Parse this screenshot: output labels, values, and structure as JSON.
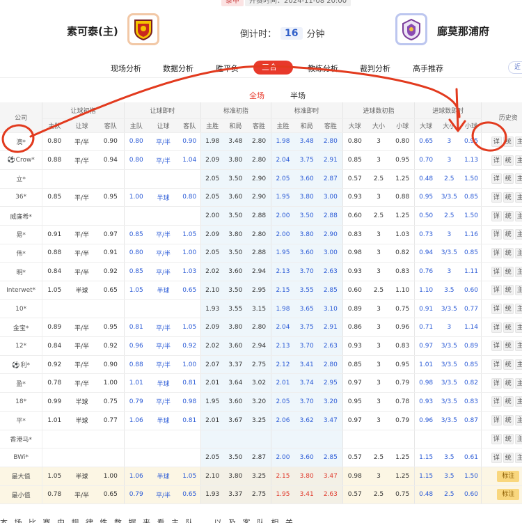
{
  "top": {
    "league": "泰甲",
    "kickoff": "开赛时间：2024-11-08 20:00"
  },
  "match": {
    "home": "素可泰(主)",
    "away": "廊莫那浦府",
    "countdown_label": "倒计时：",
    "countdown_value": "16",
    "countdown_unit": "分钟"
  },
  "nav": {
    "tabs": [
      "现场分析",
      "数据分析",
      "胜平负",
      "三合一",
      "教练分析",
      "裁判分析",
      "高手推荐"
    ],
    "active": "三合一",
    "more": "近"
  },
  "subtabs": {
    "items": [
      "全场",
      "半场"
    ],
    "active": "全场"
  },
  "table": {
    "group_headers": [
      "让球初指",
      "让球即时",
      "标准初指",
      "标准即时",
      "进球数初指",
      "进球数即时",
      "历史资"
    ],
    "company_header": "公司",
    "sub_headers": {
      "handicap": [
        "主队",
        "让球",
        "客队"
      ],
      "standard": [
        "主胜",
        "和局",
        "客胜"
      ],
      "goals": [
        "大球",
        "大小",
        "小球"
      ]
    },
    "action_labels": [
      "详",
      "统",
      "主"
    ],
    "note_label": "标注",
    "rows": [
      {
        "company": "澳*",
        "ball": false,
        "ah_init": [
          "0.80",
          "平/半",
          "0.90"
        ],
        "ah_live": [
          "0.80",
          "平/半",
          "0.90"
        ],
        "std_init": [
          "1.98",
          "3.48",
          "2.80"
        ],
        "std_live": [
          "1.98",
          "3.48",
          "2.80"
        ],
        "ou_init": [
          "0.80",
          "3",
          "0.80"
        ],
        "ou_live": [
          "0.65",
          "3",
          "0.95"
        ]
      },
      {
        "company": "Crow*",
        "ball": true,
        "ah_init": [
          "0.88",
          "平/半",
          "0.94"
        ],
        "ah_live": [
          "0.80",
          "平/半",
          "1.04"
        ],
        "std_init": [
          "2.09",
          "3.80",
          "2.80"
        ],
        "std_live": [
          "2.04",
          "3.75",
          "2.91"
        ],
        "ou_init": [
          "0.85",
          "3",
          "0.95"
        ],
        "ou_live": [
          "0.70",
          "3",
          "1.13"
        ]
      },
      {
        "company": "立*",
        "ball": false,
        "ah_init": [
          "",
          "",
          ""
        ],
        "ah_live": [
          "",
          "",
          ""
        ],
        "std_init": [
          "2.05",
          "3.50",
          "2.90"
        ],
        "std_live": [
          "2.05",
          "3.60",
          "2.87"
        ],
        "ou_init": [
          "0.57",
          "2.5",
          "1.25"
        ],
        "ou_live": [
          "0.48",
          "2.5",
          "1.50"
        ]
      },
      {
        "company": "36*",
        "ball": false,
        "ah_init": [
          "0.85",
          "平/半",
          "0.95"
        ],
        "ah_live": [
          "1.00",
          "半球",
          "0.80"
        ],
        "std_init": [
          "2.05",
          "3.60",
          "2.90"
        ],
        "std_live": [
          "1.95",
          "3.80",
          "3.00"
        ],
        "ou_init": [
          "0.93",
          "3",
          "0.88"
        ],
        "ou_live": [
          "0.95",
          "3/3.5",
          "0.85"
        ]
      },
      {
        "company": "威廉希*",
        "ball": false,
        "ah_init": [
          "",
          "",
          ""
        ],
        "ah_live": [
          "",
          "",
          ""
        ],
        "std_init": [
          "2.00",
          "3.50",
          "2.88"
        ],
        "std_live": [
          "2.00",
          "3.50",
          "2.88"
        ],
        "ou_init": [
          "0.60",
          "2.5",
          "1.25"
        ],
        "ou_live": [
          "0.50",
          "2.5",
          "1.50"
        ]
      },
      {
        "company": "易*",
        "ball": false,
        "ah_init": [
          "0.91",
          "平/半",
          "0.97"
        ],
        "ah_live": [
          "0.85",
          "平/半",
          "1.05"
        ],
        "std_init": [
          "2.09",
          "3.80",
          "2.80"
        ],
        "std_live": [
          "2.00",
          "3.80",
          "2.90"
        ],
        "ou_init": [
          "0.83",
          "3",
          "1.03"
        ],
        "ou_live": [
          "0.73",
          "3",
          "1.16"
        ]
      },
      {
        "company": "伟*",
        "ball": false,
        "ah_init": [
          "0.88",
          "平/半",
          "0.91"
        ],
        "ah_live": [
          "0.80",
          "平/半",
          "1.00"
        ],
        "std_init": [
          "2.05",
          "3.50",
          "2.88"
        ],
        "std_live": [
          "1.95",
          "3.60",
          "3.00"
        ],
        "ou_init": [
          "0.98",
          "3",
          "0.82"
        ],
        "ou_live": [
          "0.94",
          "3/3.5",
          "0.85"
        ]
      },
      {
        "company": "明*",
        "ball": false,
        "ah_init": [
          "0.84",
          "平/半",
          "0.92"
        ],
        "ah_live": [
          "0.85",
          "平/半",
          "1.03"
        ],
        "std_init": [
          "2.02",
          "3.60",
          "2.94"
        ],
        "std_live": [
          "2.13",
          "3.70",
          "2.63"
        ],
        "ou_init": [
          "0.93",
          "3",
          "0.83"
        ],
        "ou_live": [
          "0.76",
          "3",
          "1.11"
        ]
      },
      {
        "company": "Interwet*",
        "ball": false,
        "ah_init": [
          "1.05",
          "半球",
          "0.65"
        ],
        "ah_live": [
          "1.05",
          "半球",
          "0.65"
        ],
        "std_init": [
          "2.10",
          "3.50",
          "2.95"
        ],
        "std_live": [
          "2.15",
          "3.55",
          "2.85"
        ],
        "ou_init": [
          "0.60",
          "2.5",
          "1.10"
        ],
        "ou_live": [
          "1.10",
          "3.5",
          "0.60"
        ]
      },
      {
        "company": "10*",
        "ball": false,
        "ah_init": [
          "",
          "",
          ""
        ],
        "ah_live": [
          "",
          "",
          ""
        ],
        "std_init": [
          "1.93",
          "3.55",
          "3.15"
        ],
        "std_live": [
          "1.98",
          "3.65",
          "3.10"
        ],
        "ou_init": [
          "0.89",
          "3",
          "0.75"
        ],
        "ou_live": [
          "0.91",
          "3/3.5",
          "0.77"
        ]
      },
      {
        "company": "金宝*",
        "ball": false,
        "ah_init": [
          "0.89",
          "平/半",
          "0.95"
        ],
        "ah_live": [
          "0.81",
          "平/半",
          "1.05"
        ],
        "std_init": [
          "2.09",
          "3.80",
          "2.80"
        ],
        "std_live": [
          "2.04",
          "3.75",
          "2.91"
        ],
        "ou_init": [
          "0.86",
          "3",
          "0.96"
        ],
        "ou_live": [
          "0.71",
          "3",
          "1.14"
        ]
      },
      {
        "company": "12*",
        "ball": false,
        "ah_init": [
          "0.84",
          "平/半",
          "0.92"
        ],
        "ah_live": [
          "0.96",
          "平/半",
          "0.92"
        ],
        "std_init": [
          "2.02",
          "3.60",
          "2.94"
        ],
        "std_live": [
          "2.13",
          "3.70",
          "2.63"
        ],
        "ou_init": [
          "0.93",
          "3",
          "0.83"
        ],
        "ou_live": [
          "0.97",
          "3/3.5",
          "0.89"
        ]
      },
      {
        "company": "利*",
        "ball": true,
        "ah_init": [
          "0.92",
          "平/半",
          "0.90"
        ],
        "ah_live": [
          "0.88",
          "平/半",
          "1.00"
        ],
        "std_init": [
          "2.07",
          "3.37",
          "2.75"
        ],
        "std_live": [
          "2.12",
          "3.41",
          "2.80"
        ],
        "ou_init": [
          "0.85",
          "3",
          "0.95"
        ],
        "ou_live": [
          "1.01",
          "3/3.5",
          "0.85"
        ]
      },
      {
        "company": "盈*",
        "ball": false,
        "ah_init": [
          "0.78",
          "平/半",
          "1.00"
        ],
        "ah_live": [
          "1.01",
          "半球",
          "0.81"
        ],
        "std_init": [
          "2.01",
          "3.64",
          "3.02"
        ],
        "std_live": [
          "2.01",
          "3.74",
          "2.95"
        ],
        "ou_init": [
          "0.97",
          "3",
          "0.79"
        ],
        "ou_live": [
          "0.98",
          "3/3.5",
          "0.82"
        ]
      },
      {
        "company": "18*",
        "ball": false,
        "ah_init": [
          "0.99",
          "半球",
          "0.75"
        ],
        "ah_live": [
          "0.79",
          "平/半",
          "0.98"
        ],
        "std_init": [
          "1.95",
          "3.60",
          "3.20"
        ],
        "std_live": [
          "2.05",
          "3.70",
          "3.20"
        ],
        "ou_init": [
          "0.95",
          "3",
          "0.78"
        ],
        "ou_live": [
          "0.93",
          "3/3.5",
          "0.83"
        ]
      },
      {
        "company": "平*",
        "ball": false,
        "ah_init": [
          "1.01",
          "半球",
          "0.77"
        ],
        "ah_live": [
          "1.06",
          "半球",
          "0.81"
        ],
        "std_init": [
          "2.01",
          "3.67",
          "3.25"
        ],
        "std_live": [
          "2.06",
          "3.62",
          "3.47"
        ],
        "ou_init": [
          "0.97",
          "3",
          "0.79"
        ],
        "ou_live": [
          "0.96",
          "3/3.5",
          "0.87"
        ]
      },
      {
        "company": "香港马*",
        "ball": false,
        "ah_init": [
          "",
          "",
          ""
        ],
        "ah_live": [
          "",
          "",
          ""
        ],
        "std_init": [
          "",
          "",
          ""
        ],
        "std_live": [
          "",
          "",
          ""
        ],
        "ou_init": [
          "",
          "",
          ""
        ],
        "ou_live": [
          "",
          "",
          ""
        ]
      },
      {
        "company": "BWi*",
        "ball": false,
        "ah_init": [
          "",
          "",
          ""
        ],
        "ah_live": [
          "",
          "",
          ""
        ],
        "std_init": [
          "2.05",
          "3.50",
          "2.87"
        ],
        "std_live": [
          "2.00",
          "3.60",
          "2.85"
        ],
        "ou_init": [
          "0.57",
          "2.5",
          "1.25"
        ],
        "ou_live": [
          "1.15",
          "3.5",
          "0.61"
        ]
      }
    ],
    "summary": [
      {
        "label": "最大值",
        "kind": "max",
        "ah_init": [
          "1.05",
          "半球",
          "1.00"
        ],
        "ah_live": [
          "1.06",
          "半球",
          "1.05"
        ],
        "std_init": [
          "2.10",
          "3.80",
          "3.25"
        ],
        "std_live": [
          "2.15",
          "3.80",
          "3.47"
        ],
        "ou_init": [
          "0.98",
          "3",
          "1.25"
        ],
        "ou_live": [
          "1.15",
          "3.5",
          "1.50"
        ]
      },
      {
        "label": "最小值",
        "kind": "min",
        "ah_init": [
          "0.78",
          "平/半",
          "0.65"
        ],
        "ah_live": [
          "0.79",
          "平/半",
          "0.65"
        ],
        "std_init": [
          "1.93",
          "3.37",
          "2.75"
        ],
        "std_live": [
          "1.95",
          "3.41",
          "2.63"
        ],
        "ou_init": [
          "0.57",
          "2.5",
          "0.75"
        ],
        "ou_live": [
          "0.48",
          "2.5",
          "0.60"
        ]
      }
    ]
  },
  "bottom_text": "本 场 比 赛 中 规 律 性 数 据 来 看 主 队 … 以 及 客 队 相 关 …",
  "colors": {
    "accent": "#e8392b",
    "link_blue": "#2a5ad6",
    "annotation_red": "#e23a1e"
  },
  "icons": {
    "home_logo": "shield-crest-icon",
    "away_logo": "purple-crest-icon",
    "ball": "football-icon"
  }
}
